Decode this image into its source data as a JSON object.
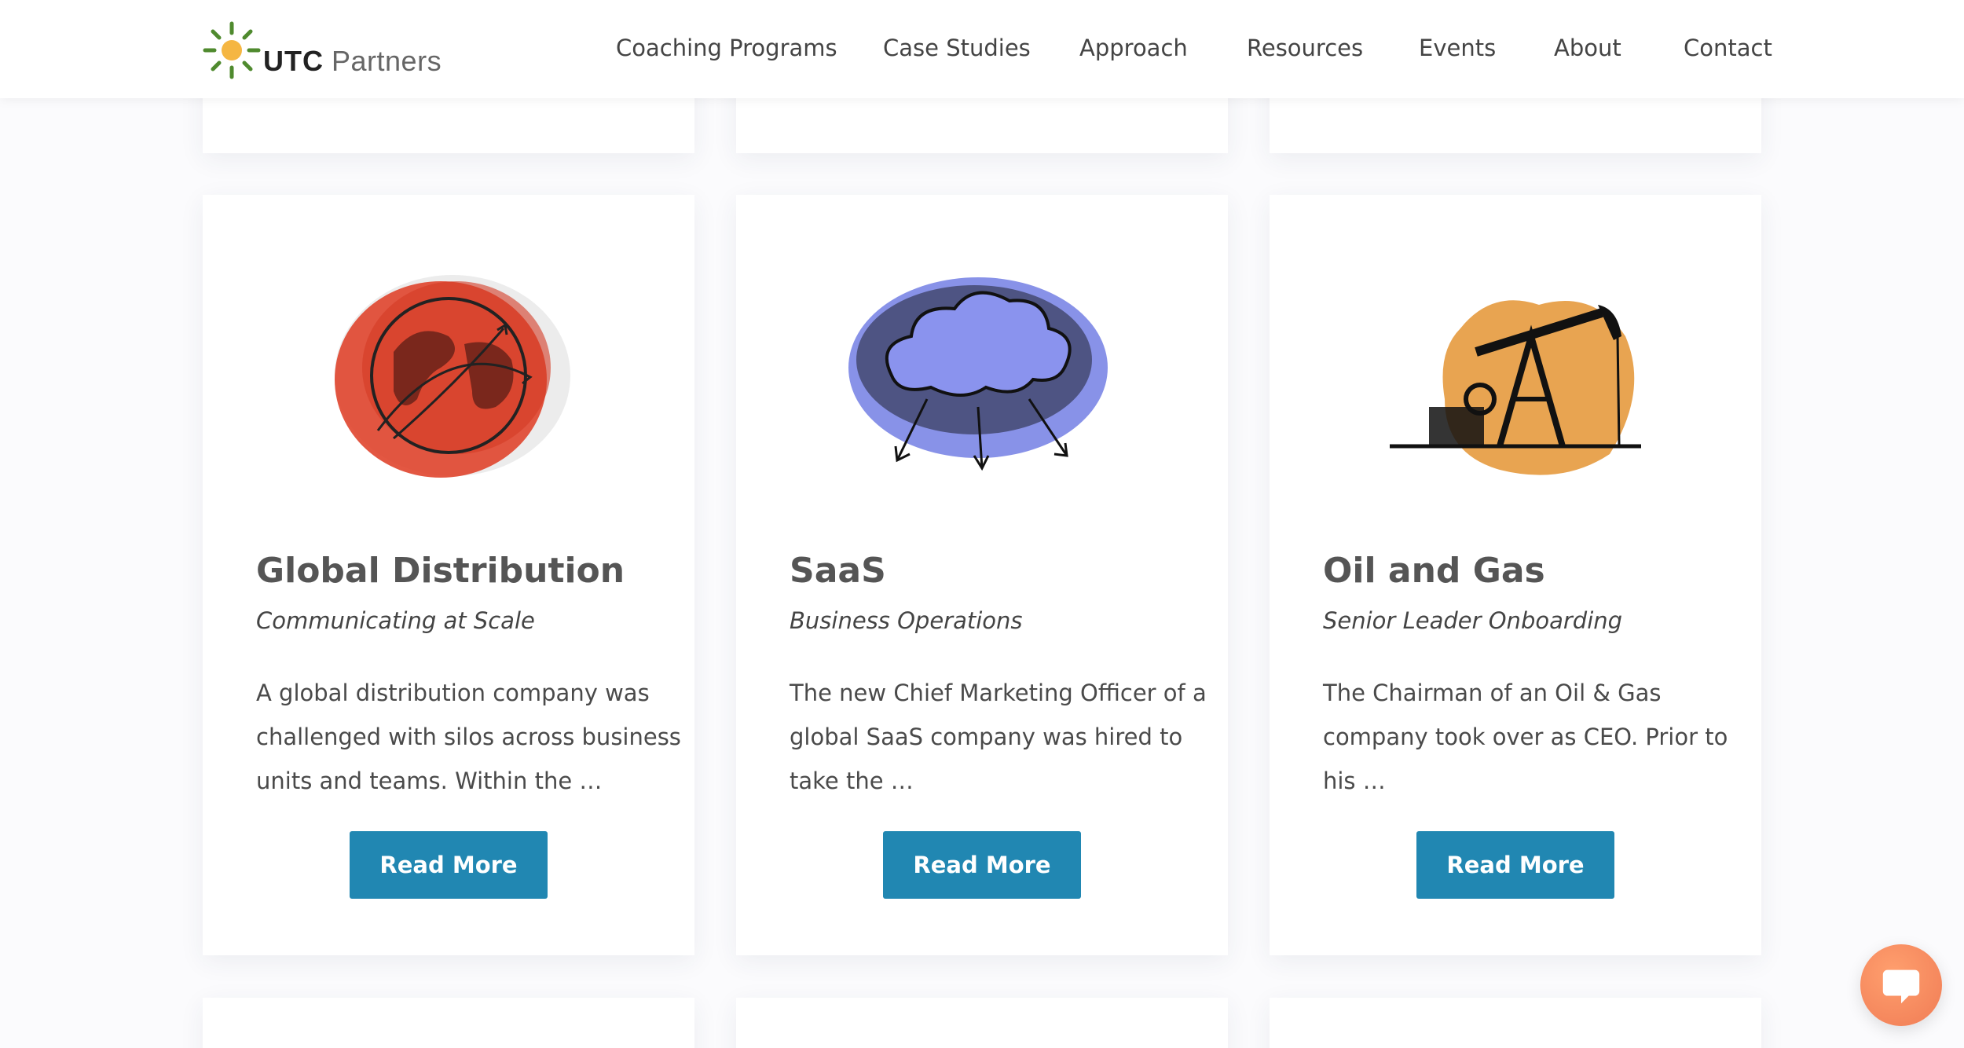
{
  "header": {
    "logo": {
      "brand_bold": "UTC",
      "brand_light": "Partners",
      "icon": "sun-logo-icon"
    },
    "nav": [
      {
        "label": "Coaching Programs"
      },
      {
        "label": "Case Studies"
      },
      {
        "label": "Approach"
      },
      {
        "label": "Resources"
      },
      {
        "label": "Events"
      },
      {
        "label": "About"
      },
      {
        "label": "Contact"
      }
    ]
  },
  "cards": [
    {
      "title": "Global Distribution",
      "subtitle": "Communicating at Scale",
      "description_lines": [
        "A global distribution company was",
        "challenged with silos across business",
        "units and teams. Within the …"
      ],
      "button": "Read More",
      "icon": "globe-arrows-icon",
      "accent": "#e0452e"
    },
    {
      "title": "SaaS",
      "subtitle": "Business Operations",
      "description_lines": [
        "The new Chief Marketing Officer of a",
        "global SaaS company was hired to",
        "take the …"
      ],
      "button": "Read More",
      "icon": "cloud-arrows-icon",
      "accent": "#7b86e6"
    },
    {
      "title": "Oil and Gas",
      "subtitle": "Senior Leader Onboarding",
      "description_lines": [
        "The Chairman of an Oil & Gas",
        "company took over as CEO. Prior to",
        "his …"
      ],
      "button": "Read More",
      "icon": "oil-pump-icon",
      "accent": "#e59a3e"
    }
  ],
  "colors": {
    "button": "#2187b2",
    "chat": "#f58a5e",
    "logo_sun": "#f5b642",
    "logo_rays": "#4f8a2e"
  },
  "chat_widget": {
    "icon": "chat-bubble-icon"
  }
}
